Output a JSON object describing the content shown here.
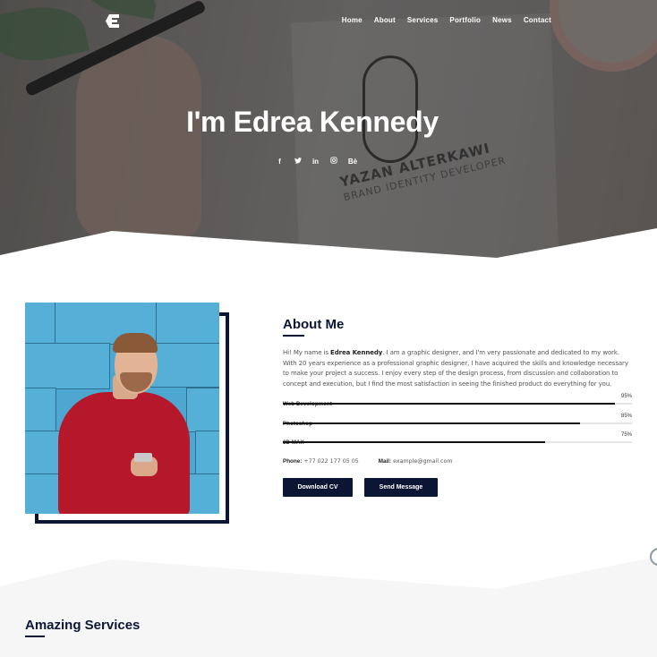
{
  "header": {
    "logo_icon": "letter-e-logo-icon",
    "nav": [
      {
        "label": "Home"
      },
      {
        "label": "About"
      },
      {
        "label": "Services"
      },
      {
        "label": "Portfolio"
      },
      {
        "label": "News"
      },
      {
        "label": "Contact"
      }
    ]
  },
  "hero": {
    "title": "I'm Edrea Kennedy",
    "background_text": {
      "line1": "YAZAN ALTERKAWI",
      "line2": "BRAND IDENTITY DEVELOPER"
    },
    "socials": [
      {
        "icon": "facebook-icon",
        "glyph": "f"
      },
      {
        "icon": "twitter-icon",
        "glyph": "ᵛ"
      },
      {
        "icon": "linkedin-icon",
        "glyph": "in"
      },
      {
        "icon": "instagram-icon",
        "glyph": "◎"
      },
      {
        "icon": "behance-icon",
        "glyph": "Bė"
      }
    ]
  },
  "about": {
    "title": "About Me",
    "intro_prefix": "Hi! My name is ",
    "name": "Edrea Kennedy",
    "intro_suffix": ". I am a graphic designer, and I'm very passionate and dedicated to my work. With 20 years experience as a professional graphic designer, I have acquired the skills and knowledge necessary to make your project a success. I enjoy every step of the design process, from discussion and collaboration to concept and execution, but I find the most satisfaction in seeing the finished product do everything for you.",
    "skills": [
      {
        "label": "Web Development",
        "percent_label": "95%",
        "value": 0.95
      },
      {
        "label": "Photoshop",
        "percent_label": "85%",
        "value": 0.85
      },
      {
        "label": "3D MAX",
        "percent_label": "75%",
        "value": 0.75
      }
    ],
    "phone_label": "Phone:",
    "phone": "+77 022 177 05 05",
    "mail_label": "Mail:",
    "mail": "example@gmail.com",
    "buttons": {
      "download_cv": "Download CV",
      "send_message": "Send Message"
    }
  },
  "services": {
    "title": "Amazing Services"
  },
  "colors": {
    "accent": "#0b1634",
    "services_bg": "#f6f6f7"
  }
}
